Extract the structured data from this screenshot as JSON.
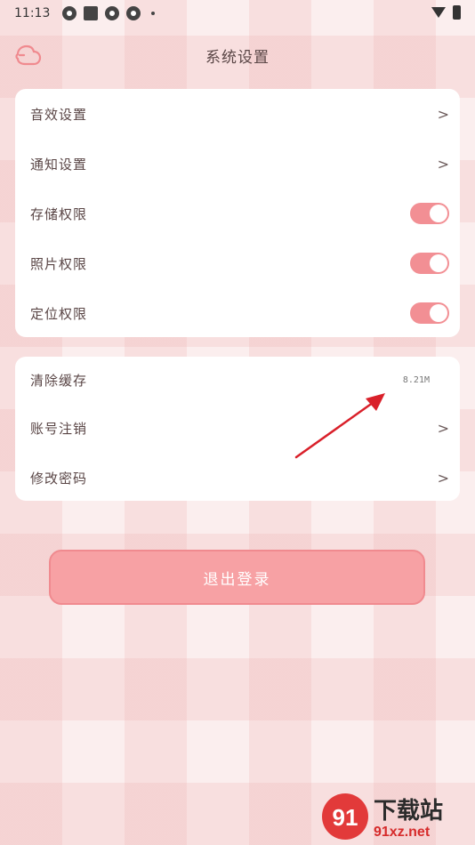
{
  "status_bar": {
    "time": "11:13",
    "icons": [
      "app-icon",
      "square-icon",
      "app-icon",
      "app-icon",
      "dot-icon"
    ],
    "right_icons": [
      "wifi-icon",
      "battery-icon"
    ]
  },
  "header": {
    "back_icon": "back-cloud-icon",
    "title": "系统设置"
  },
  "group1": {
    "items": [
      {
        "label": "音效设置",
        "control": "chevron"
      },
      {
        "label": "通知设置",
        "control": "chevron"
      },
      {
        "label": "存储权限",
        "control": "toggle",
        "on": true
      },
      {
        "label": "照片权限",
        "control": "toggle",
        "on": true
      },
      {
        "label": "定位权限",
        "control": "toggle",
        "on": true
      }
    ]
  },
  "group2": {
    "items": [
      {
        "label": "清除缓存",
        "value": "8.21M"
      },
      {
        "label": "账号注销",
        "control": "chevron"
      },
      {
        "label": "修改密码",
        "control": "chevron"
      }
    ]
  },
  "chevron_glyph": ">",
  "logout": {
    "label": "退出登录"
  },
  "watermark": {
    "main": "下载站",
    "sub": "91xz.net",
    "logo_text": "91"
  },
  "colors": {
    "accent": "#f28f94",
    "button": "#f7a1a4",
    "text": "#5a4646",
    "annotation_arrow": "#d9202a"
  }
}
